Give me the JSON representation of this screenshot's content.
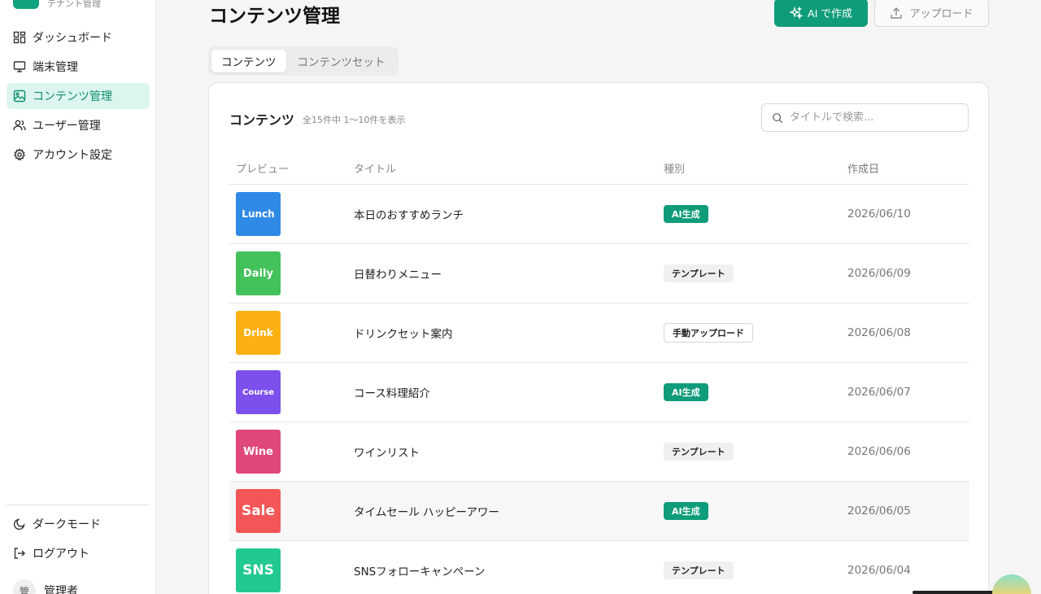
{
  "brand": {
    "subtitle": "テナント管理"
  },
  "nav": [
    {
      "label": "ダッシュボード",
      "icon": "dashboard-icon",
      "active": false
    },
    {
      "label": "端末管理",
      "icon": "monitor-icon",
      "active": false
    },
    {
      "label": "コンテンツ管理",
      "icon": "image-icon",
      "active": true
    },
    {
      "label": "ユーザー管理",
      "icon": "users-icon",
      "active": false
    },
    {
      "label": "アカウント設定",
      "icon": "gear-icon",
      "active": false
    }
  ],
  "bottom_nav": {
    "dark_mode": "ダークモード",
    "logout": "ログアウト"
  },
  "user": {
    "name": "管理者",
    "avatar_char": "管"
  },
  "page": {
    "title": "コンテンツ管理",
    "ai_button": "AI で作成",
    "upload_button": "アップロード"
  },
  "tabs": [
    {
      "label": "コンテンツ",
      "active": true
    },
    {
      "label": "コンテンツセット",
      "active": false
    }
  ],
  "card": {
    "title": "コンテンツ",
    "count": "全15件中 1〜10件を表示",
    "search_placeholder": "タイトルで検索..."
  },
  "table": {
    "headers": [
      "プレビュー",
      "タイトル",
      "種別",
      "作成日"
    ],
    "rows": [
      {
        "thumb_text": "Lunch",
        "thumb_color": "#2f8ae6",
        "title": "本日のおすすめランチ",
        "type": "AI生成",
        "type_kind": "ai",
        "date": "2026/06/10"
      },
      {
        "thumb_text": "Daily",
        "thumb_color": "#43c15a",
        "title": "日替わりメニュー",
        "type": "テンプレート",
        "type_kind": "tpl",
        "date": "2026/06/09"
      },
      {
        "thumb_text": "Drink",
        "thumb_color": "#fbb012",
        "title": "ドリンクセット案内",
        "type": "手動アップロード",
        "type_kind": "up",
        "date": "2026/06/08"
      },
      {
        "thumb_text": "Course",
        "thumb_color": "#7b50ec",
        "title": "コース料理紹介",
        "type": "AI生成",
        "type_kind": "ai",
        "date": "2026/06/07"
      },
      {
        "thumb_text": "Wine",
        "thumb_color": "#e0487a",
        "title": "ワインリスト",
        "type": "テンプレート",
        "type_kind": "tpl",
        "date": "2026/06/06"
      },
      {
        "thumb_text": "Sale",
        "thumb_color": "#f25656",
        "title": "タイムセール ハッピーアワー",
        "type": "AI生成",
        "type_kind": "ai",
        "date": "2026/06/05"
      },
      {
        "thumb_text": "SNS",
        "thumb_color": "#22c98e",
        "title": "SNSフォローキャンペーン",
        "type": "テンプレート",
        "type_kind": "tpl",
        "date": "2026/06/04"
      }
    ]
  }
}
